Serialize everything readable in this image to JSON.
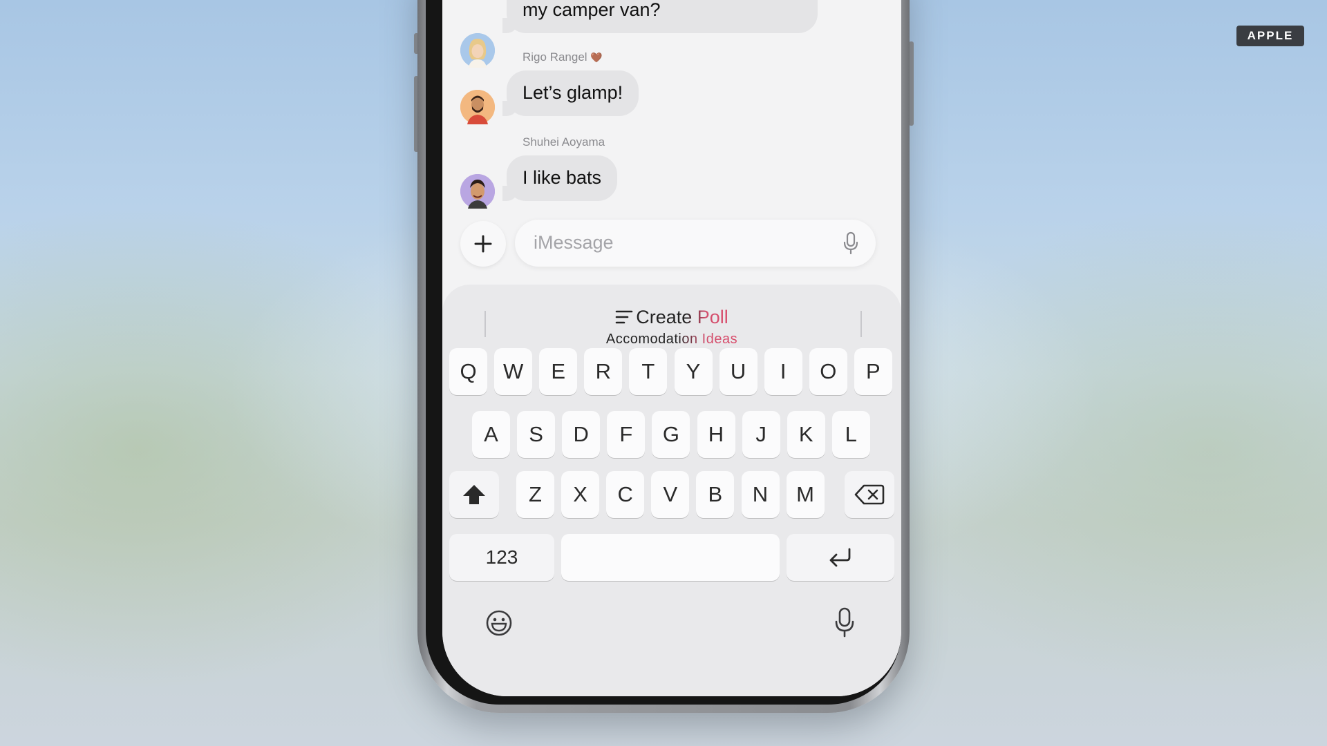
{
  "badge": "APPLE",
  "messages": [
    {
      "sender": "",
      "text": "Terrible options. Can we sleep in my camper van?"
    },
    {
      "sender": "Rigo Rangel",
      "sender_emoji": "🤎",
      "text": "Let’s glamp!"
    },
    {
      "sender": "Shuhei Aoyama",
      "text": "I like bats"
    }
  ],
  "composer": {
    "placeholder": "iMessage"
  },
  "suggestion": {
    "title": "Create Poll",
    "subtitle": "Accomodation Ideas"
  },
  "keyboard": {
    "row1": [
      "Q",
      "W",
      "E",
      "R",
      "T",
      "Y",
      "U",
      "I",
      "O",
      "P"
    ],
    "row2": [
      "A",
      "S",
      "D",
      "F",
      "G",
      "H",
      "J",
      "K",
      "L"
    ],
    "row3": [
      "Z",
      "X",
      "C",
      "V",
      "B",
      "N",
      "M"
    ],
    "numbers_key": "123"
  },
  "icons": {
    "plus": "plus-icon",
    "mic": "microphone-icon",
    "shift": "shift-icon",
    "delete": "delete-icon",
    "return": "return-icon",
    "emoji": "emoji-icon",
    "list": "list-icon"
  },
  "colors": {
    "accent_pink": "#d94b6a",
    "bubble_gray": "#e4e4e6"
  }
}
